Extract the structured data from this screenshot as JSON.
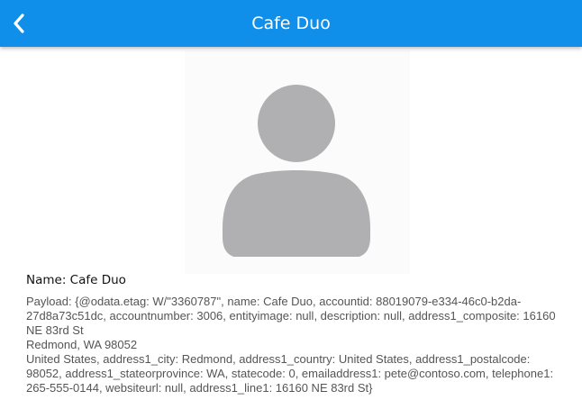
{
  "header": {
    "title": "Cafe Duo",
    "back_icon": "chevron-left-icon",
    "background_color": "#0f8fea"
  },
  "avatar": {
    "icon": "person-silhouette-icon",
    "color": "#b0b0b2"
  },
  "details": {
    "name_line": "Name: Cafe Duo",
    "payload_text": "Payload: {@odata.etag: W/\"3360787\", name: Cafe Duo, accountid: 88019079-e334-46c0-b2da-27d8a73c51dc, accountnumber: 3006, entityimage: null, description: null, address1_composite: 16160 NE 83rd St\nRedmond, WA 98052\nUnited States, address1_city: Redmond, address1_country: United States, address1_postalcode: 98052, address1_stateorprovince: WA, statecode: 0, emailaddress1: pete@contoso.com, telephone1: 265-555-0144, websiteurl: null, address1_line1: 16160 NE 83rd St}"
  }
}
